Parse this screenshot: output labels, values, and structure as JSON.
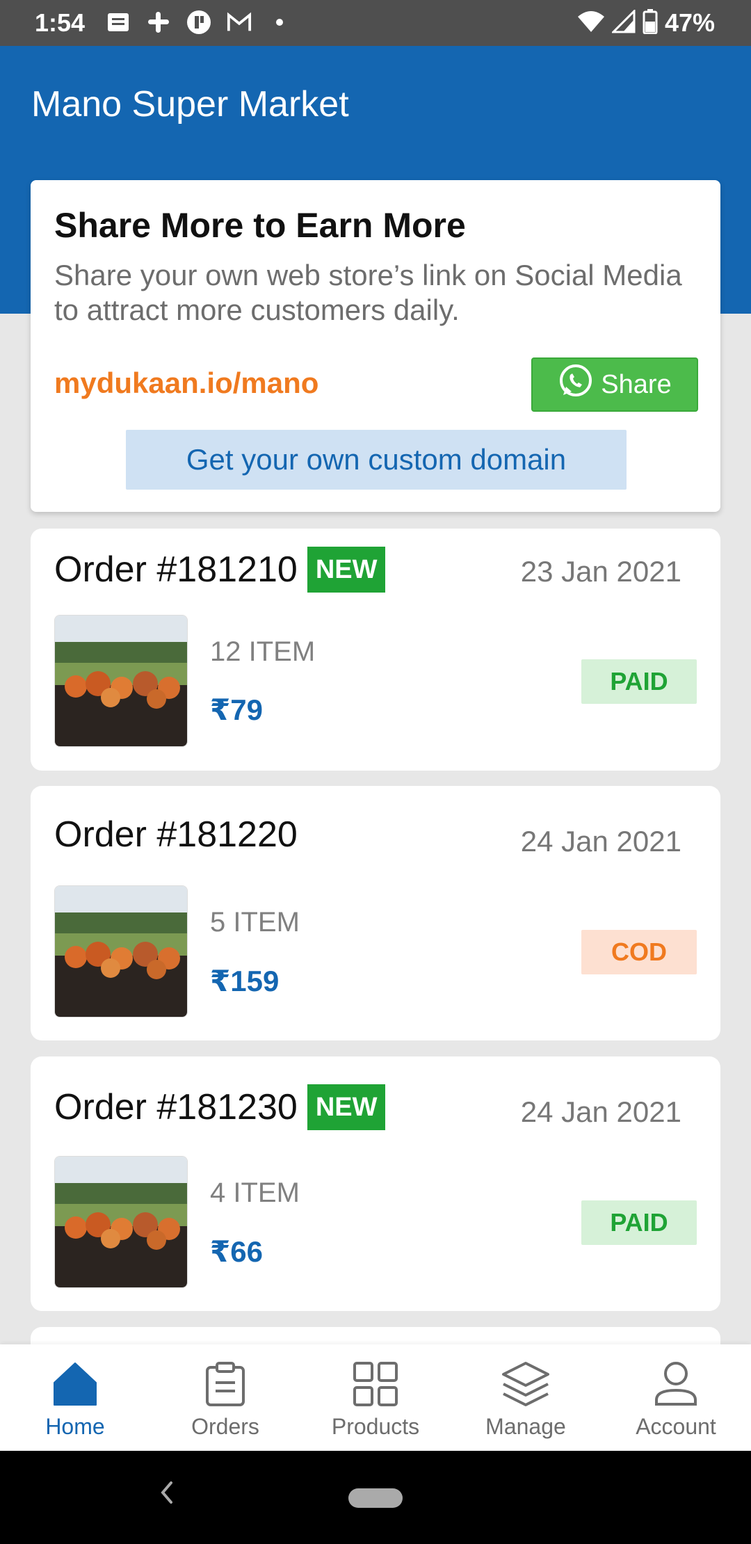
{
  "status_bar": {
    "time": "1:54",
    "battery": "47%"
  },
  "header": {
    "title": "Mano Super Market"
  },
  "promo": {
    "title": "Share More to Earn More",
    "description": "Share your own web store’s link on Social Media to attract more customers daily.",
    "store_link": "mydukaan.io/mano",
    "share_label": "Share",
    "domain_button": "Get your own custom domain"
  },
  "orders": [
    {
      "title": "Order #181210",
      "badge": "NEW",
      "date": "23 Jan 2021",
      "items": "12 ITEM",
      "price": "₹79",
      "payment": "PAID"
    },
    {
      "title": "Order #181220",
      "badge": "",
      "date": "24 Jan 2021",
      "items": "5 ITEM",
      "price": "₹159",
      "payment": "COD"
    },
    {
      "title": "Order #181230",
      "badge": "NEW",
      "date": "24 Jan 2021",
      "items": "4 ITEM",
      "price": "₹66",
      "payment": "PAID"
    }
  ],
  "nav": {
    "items": [
      {
        "label": "Home",
        "icon": "home-icon"
      },
      {
        "label": "Orders",
        "icon": "clipboard-icon"
      },
      {
        "label": "Products",
        "icon": "grid-icon"
      },
      {
        "label": "Manage",
        "icon": "layers-icon"
      },
      {
        "label": "Account",
        "icon": "person-icon"
      }
    ]
  },
  "colors": {
    "brand": "#1466b1",
    "accent": "#f07a1f",
    "success": "#1fa335",
    "share_green": "#4cbb4b"
  }
}
